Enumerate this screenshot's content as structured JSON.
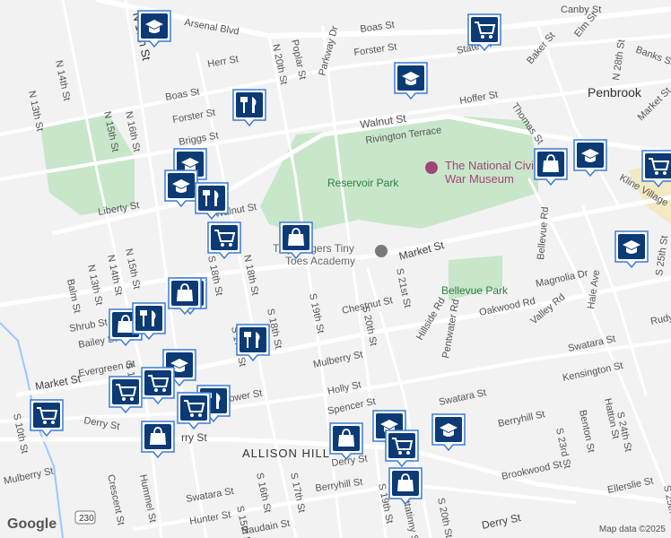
{
  "map": {
    "attribution": "Map data ©2025",
    "logo": "Google",
    "area_labels": {
      "penbrook": "Penbrook",
      "allison_hill": "ALLISON HILL"
    },
    "parks": {
      "reservoir": "Reservoir Park",
      "bellevue": "Bellevue Park"
    },
    "poi": {
      "museum_line1": "The National Civil",
      "museum_line2": "War Museum",
      "academy_line1": "Tiny Fingers Tiny",
      "academy_line2": "Toes Academy"
    },
    "streets": {
      "arsenal": "Arsenal Blvd",
      "canby": "Canby St",
      "boas_top": "Boas St",
      "forster_top": "Forster St",
      "herr": "Herr St",
      "parkway": "Parkway Dr",
      "state": "State St",
      "banks": "Banks St",
      "elm": "Elm St",
      "baker": "Baker St",
      "thomas": "Thomas St",
      "hoffer": "Hoffer St",
      "walnut": "Walnut St",
      "rivington": "Rivington Terrace",
      "n28": "N 28th St",
      "market_right": "Market St",
      "kline": "Kline Village",
      "s25_top": "S 25th St",
      "bellevue_rd": "Bellevue Rd",
      "hale": "Hale Ave",
      "magnolia": "Magnolia Dr",
      "rudy": "Rudy Rd",
      "valley": "Valley Rd",
      "oakwood": "Oakwood Rd",
      "pentwater": "Pentwater Rd",
      "hillside": "Hillside Rd",
      "s21": "S 21st St",
      "chestnut": "Chestnut St",
      "market_mid": "Market St",
      "s20_mid": "S 20th St",
      "s19_mid": "S 19th St",
      "s18_mid": "S 18th St",
      "mulberry_mid": "Mulberry St",
      "swatara_right": "Swatara St",
      "kensington": "Kensington St",
      "swatara_mid": "Swatara St",
      "holly": "Holly St",
      "spencer": "Spencer St",
      "berryhill_right": "Berryhill St",
      "hatton": "Hatton St",
      "s24": "S 24th St",
      "benton": "Benton St",
      "s23": "S 23rd St",
      "brookwood": "Brookwood St",
      "derry_right": "Derry St",
      "ellerslie": "Ellerslie St",
      "s25_bottom": "S 25th St",
      "derry_mid": "Derry St",
      "berryhill_mid": "Berryhill St",
      "s19_bottom": "S 19th St",
      "kittatinny": "Kittatinny St",
      "s20_bottom": "S 20th St",
      "n17": "N 17th St",
      "n14": "N 14th St",
      "n13": "N 13th St",
      "boas_left": "Boas St",
      "forster_left": "Forster St",
      "briggs": "Briggs St",
      "n16": "N 16th St",
      "n15": "N 15th St",
      "n20": "N 20th St",
      "poplar": "Poplar St",
      "n19": "N 19th St",
      "liberty": "Liberty St",
      "walnut_left": "Walnut St",
      "n18": "N 18th St",
      "n15_b": "N 15th St",
      "n14_b": "N 14th St",
      "n13_b": "N 13th St",
      "balm": "Balm St",
      "shrub": "Shrub St",
      "bailey": "Bailey St",
      "market_left": "Market St",
      "s13": "S 13th St",
      "evergreen": "Evergreen St",
      "derry_left": "Derry St",
      "s10": "S 10th St",
      "mulberry_left": "Mulberry St",
      "crescent": "Crescent St",
      "hummel": "Hummel St",
      "swatara_left": "Swatara St",
      "hunter": "Hunter St",
      "s15": "S 15th St",
      "s16": "S 16th St",
      "naudain": "Naudain St",
      "s17_bottom": "S 17th St",
      "route_230": "230",
      "s17_mid": "S 17th St",
      "s18_left": "S 18th St",
      "ower": "ower St",
      "rry": "rry St"
    },
    "markers": [
      {
        "type": "school-icon"
      },
      {
        "type": "grocery-cart-icon"
      },
      {
        "type": "school-icon"
      },
      {
        "type": "restaurant-icon"
      },
      {
        "type": "school-icon"
      },
      {
        "type": "school-icon"
      },
      {
        "type": "restaurant-icon"
      },
      {
        "type": "grocery-cart-icon"
      },
      {
        "type": "shopping-bag-icon"
      },
      {
        "type": "shopping-bag-icon"
      },
      {
        "type": "school-icon"
      },
      {
        "type": "grocery-cart-icon"
      },
      {
        "type": "school-icon"
      },
      {
        "type": "restaurant-icon"
      },
      {
        "type": "shopping-bag-icon"
      },
      {
        "type": "shopping-bag-icon"
      },
      {
        "type": "restaurant-icon"
      },
      {
        "type": "school-icon"
      },
      {
        "type": "grocery-cart-icon"
      },
      {
        "type": "grocery-cart-icon"
      },
      {
        "type": "restaurant-icon"
      },
      {
        "type": "grocery-cart-icon"
      },
      {
        "type": "restaurant-icon"
      },
      {
        "type": "grocery-cart-icon"
      },
      {
        "type": "shopping-bag-icon"
      },
      {
        "type": "shopping-bag-icon"
      },
      {
        "type": "school-icon"
      },
      {
        "type": "grocery-cart-icon"
      },
      {
        "type": "school-icon"
      },
      {
        "type": "shopping-bag-icon"
      }
    ],
    "colors": {
      "road": "#ffffff",
      "park": "#c8e6c9",
      "marker": "#0b3a75"
    }
  }
}
